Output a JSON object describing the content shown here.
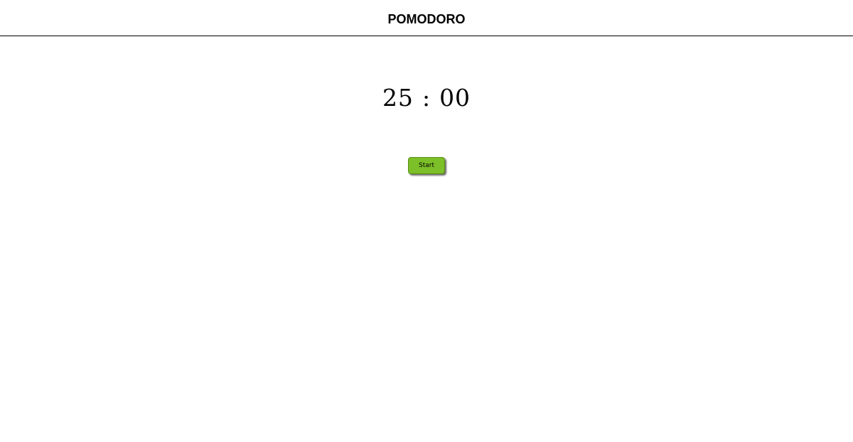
{
  "header": {
    "title": "POMODORO"
  },
  "timer": {
    "minutes": "25",
    "separator": ":",
    "seconds": "00"
  },
  "controls": {
    "start_label": "Start"
  },
  "colors": {
    "start_button_bg": "#7cbf28",
    "header_border": "#000000",
    "background": "#ffffff"
  }
}
